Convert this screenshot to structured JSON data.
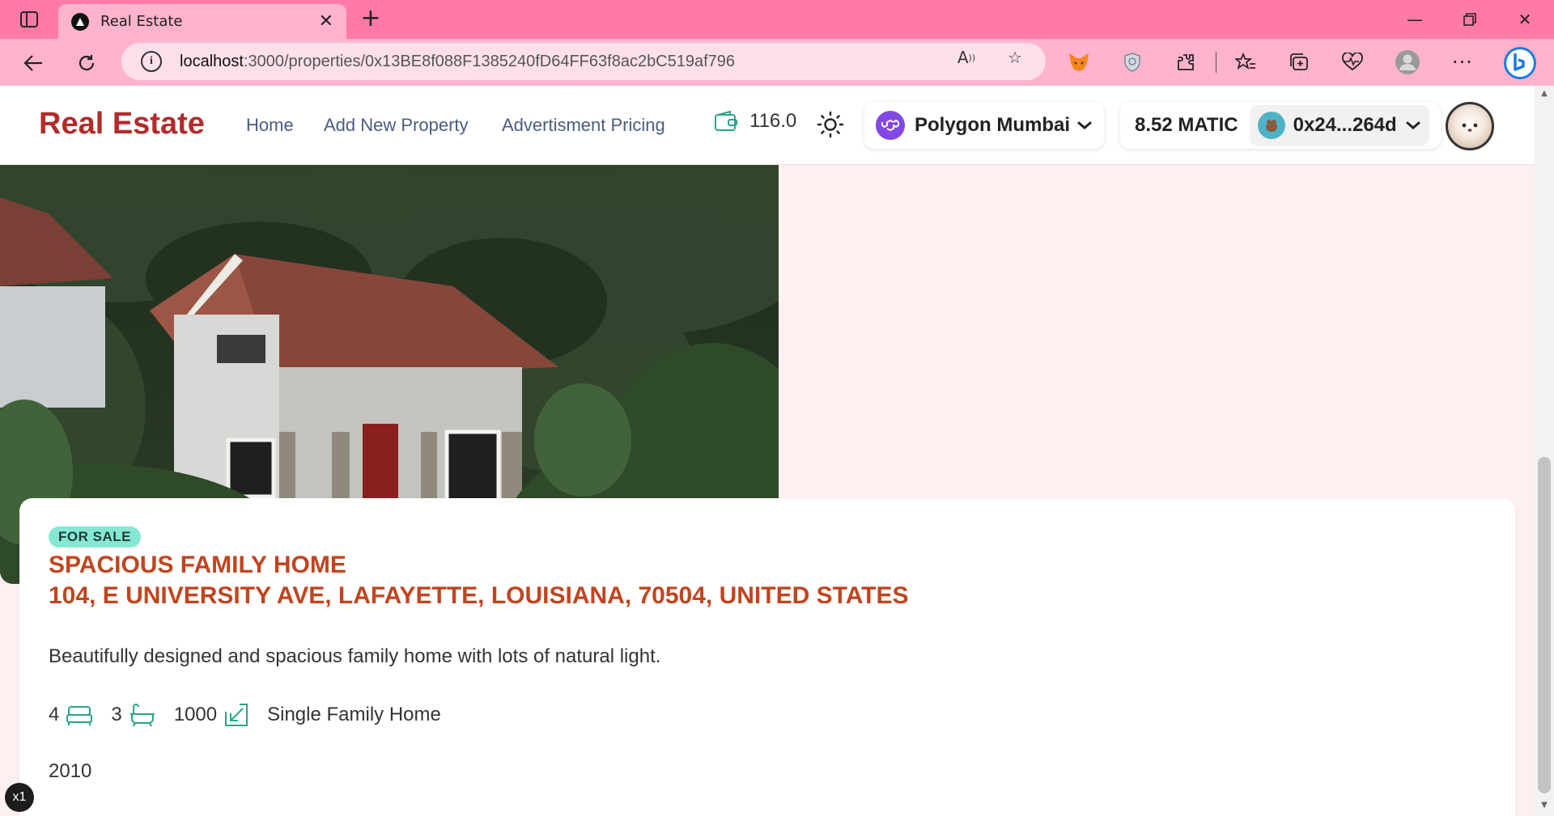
{
  "browser": {
    "tab_title": "Real Estate",
    "url_host": "localhost",
    "url_path": ":3000/properties/0x13BE8f088F1385240fD64FF63f8ac2bC519af796",
    "zoom_badge": "x1"
  },
  "header": {
    "brand": "Real Estate",
    "nav": [
      "Home",
      "Add New Property",
      "Advertisment Pricing"
    ],
    "balance": "116.0",
    "network": "Polygon Mumbai",
    "wallet_balance": "8.52 MATIC",
    "wallet_address": "0x24...264d"
  },
  "property": {
    "status": "FOR SALE",
    "title": "SPACIOUS FAMILY HOME",
    "address": "104, E UNIVERSITY AVE, LAFAYETTE, LOUISIANA, 70504, UNITED STATES",
    "description": "Beautifully designed and spacious family home with lots of natural light.",
    "bedrooms": "4",
    "bathrooms": "3",
    "area": "1000",
    "type": "Single Family Home",
    "year": "2010"
  },
  "icons": [
    "sidebar-icon",
    "favicon-icon",
    "close-icon",
    "plus-icon",
    "minimize-icon",
    "restore-icon",
    "window-close-icon",
    "back-icon",
    "refresh-icon",
    "info-icon",
    "read-aloud-icon",
    "favorite-star-icon",
    "metamask-icon",
    "shield-icon",
    "extensions-icon",
    "favorites-icon",
    "collections-icon",
    "heart-pulse-icon",
    "profile-icon",
    "more-icon",
    "bing-icon",
    "wallet-icon",
    "sun-icon",
    "polygon-icon",
    "chevron-down-icon",
    "bed-icon",
    "bath-icon",
    "area-icon"
  ],
  "colors": {
    "tabbar": "#ff7aa8",
    "brand": "#b32b2b",
    "title": "#c0451f",
    "badge": "#86e7d4",
    "page_bg": "#fdf0f0"
  }
}
